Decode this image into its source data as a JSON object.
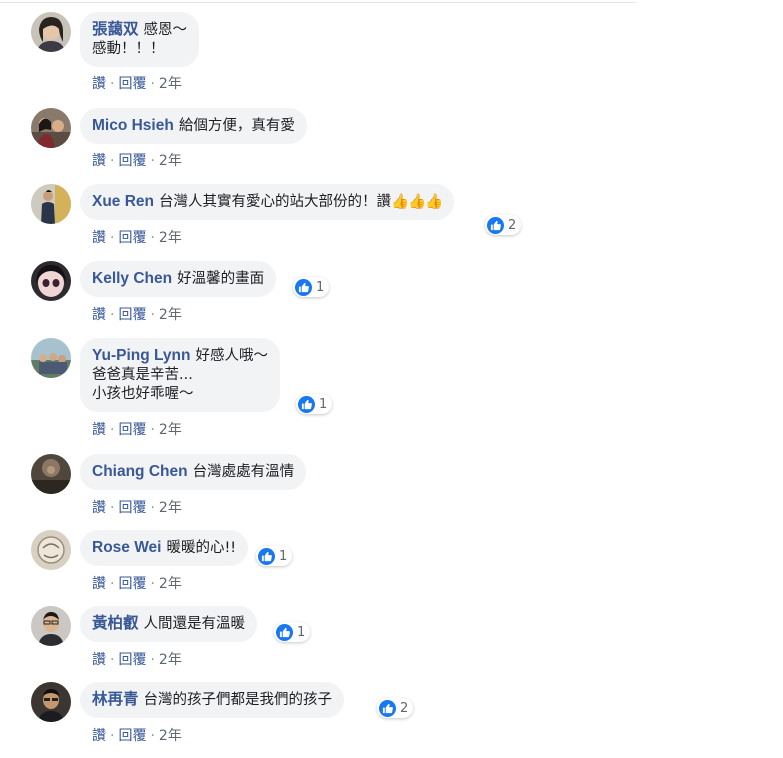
{
  "colors": {
    "author": "#385898",
    "bubble": "#f2f3f5",
    "like": "#1877f2",
    "meta": "#606770"
  },
  "actions": {
    "like": "讚",
    "reply": "回覆",
    "sep": "·"
  },
  "comments": [
    {
      "author": "張藹双",
      "lines": [
        "感恩～",
        "感動！！！"
      ],
      "time": "2年",
      "reactions": null,
      "avatar_icon": "avatar-woman-portrait"
    },
    {
      "author": "Mico Hsieh",
      "lines": [
        "給個方便，真有愛"
      ],
      "time": "2年",
      "reactions": null,
      "avatar_icon": "avatar-group-photo"
    },
    {
      "author": "Xue Ren",
      "lines": [
        "台灣人其實有愛心的站大部份的！讚"
      ],
      "thumbs": "👍👍👍",
      "time": "2年",
      "reactions": "2",
      "avatar_icon": "avatar-man-standing"
    },
    {
      "author": "Kelly Chen",
      "lines": [
        "好溫馨的畫面"
      ],
      "time": "2年",
      "reactions": "1",
      "avatar_icon": "avatar-cartoon-girl"
    },
    {
      "author": "Yu-Ping Lynn",
      "lines": [
        "好感人哦～",
        "爸爸真是辛苦...",
        "小孩也好乖喔～"
      ],
      "time": "2年",
      "reactions": "1",
      "avatar_icon": "avatar-outdoor-group"
    },
    {
      "author": "Chiang Chen",
      "lines": [
        "台灣處處有溫情"
      ],
      "time": "2年",
      "reactions": null,
      "avatar_icon": "avatar-dark-photo"
    },
    {
      "author": "Rose Wei",
      "lines": [
        "暖暖的心!!"
      ],
      "time": "2年",
      "reactions": "1",
      "avatar_icon": "avatar-sketch"
    },
    {
      "author": "黃柏叡",
      "lines": [
        "人間還是有溫暖"
      ],
      "time": "2年",
      "reactions": "1",
      "avatar_icon": "avatar-man-glasses"
    },
    {
      "author": "林再青",
      "lines": [
        "台灣的孩子們都是我們的孩子"
      ],
      "time": "2年",
      "reactions": "2",
      "avatar_icon": "avatar-man-glasses-dark"
    }
  ]
}
